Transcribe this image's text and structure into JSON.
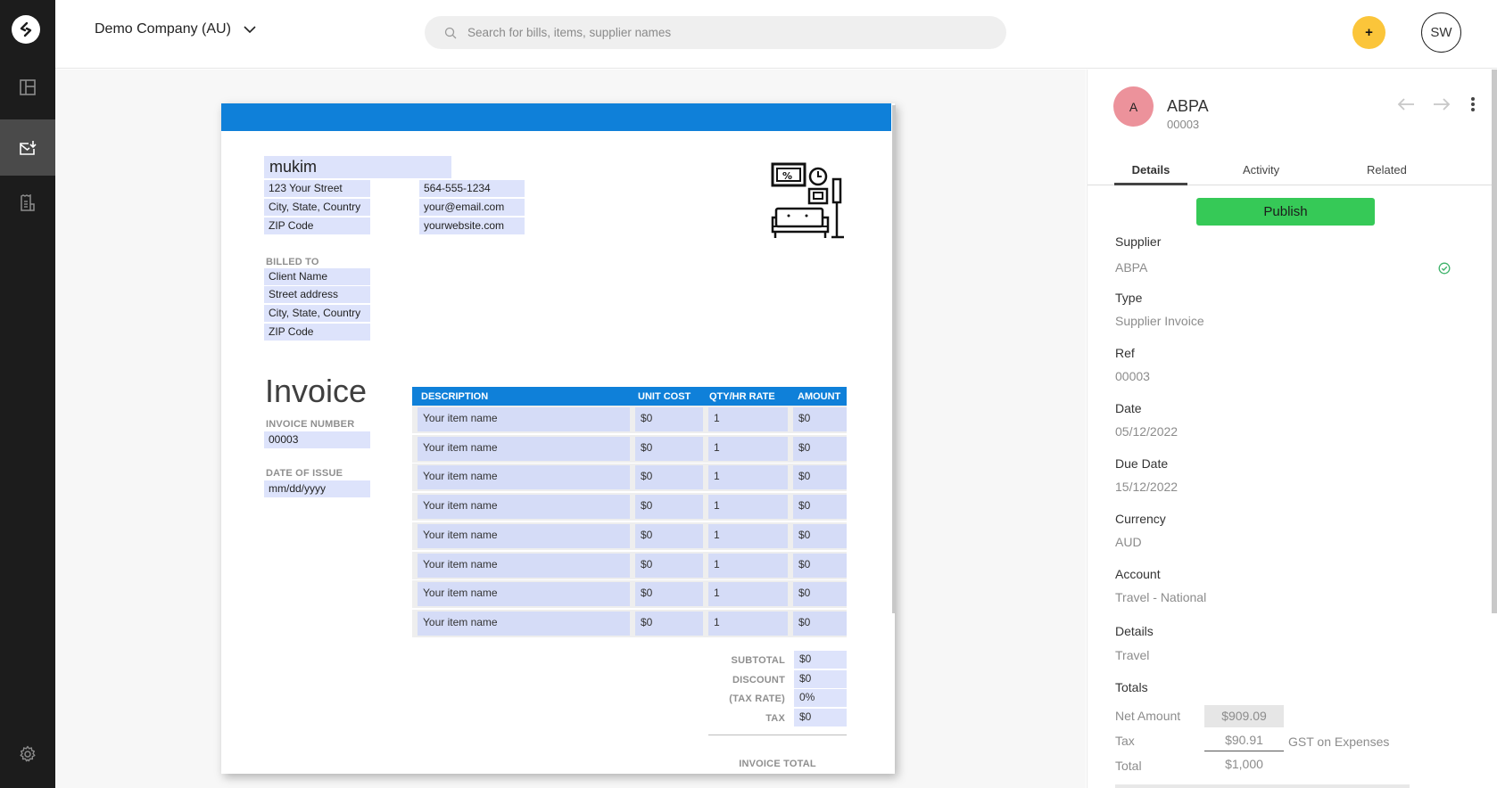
{
  "app": {
    "company": "Demo Company (AU)",
    "search_placeholder": "Search for bills, items, supplier names",
    "add_label": "+",
    "user_initials": "SW"
  },
  "sidebar": {
    "items": [
      {
        "name": "dashboard",
        "icon": "layout-icon",
        "active": false
      },
      {
        "name": "inbox",
        "icon": "inbox-download-icon",
        "active": true
      },
      {
        "name": "reports",
        "icon": "receipt-icon",
        "active": false
      }
    ],
    "settings_icon": "gear-icon"
  },
  "invoice": {
    "business_name": "mukim",
    "address": [
      "123 Your Street",
      "City, State, Country",
      "ZIP Code"
    ],
    "contact": [
      "564-555-1234",
      "your@email.com",
      "yourwebsite.com"
    ],
    "billed_to_label": "BILLED TO",
    "billed_to": [
      "Client Name",
      "Street address",
      "City, State, Country",
      "ZIP Code"
    ],
    "title": "Invoice",
    "invoice_number_label": "INVOICE NUMBER",
    "invoice_number": "00003",
    "date_label": "DATE OF ISSUE",
    "date_value": "mm/dd/yyyy",
    "columns": [
      "DESCRIPTION",
      "UNIT COST",
      "QTY/HR RATE",
      "AMOUNT"
    ],
    "rows": [
      {
        "desc": "Your item name",
        "unit": "$0",
        "qty": "1",
        "amount": "$0"
      },
      {
        "desc": "Your item name",
        "unit": "$0",
        "qty": "1",
        "amount": "$0"
      },
      {
        "desc": "Your item name",
        "unit": "$0",
        "qty": "1",
        "amount": "$0"
      },
      {
        "desc": "Your item name",
        "unit": "$0",
        "qty": "1",
        "amount": "$0"
      },
      {
        "desc": "Your item name",
        "unit": "$0",
        "qty": "1",
        "amount": "$0"
      },
      {
        "desc": "Your item name",
        "unit": "$0",
        "qty": "1",
        "amount": "$0"
      },
      {
        "desc": "Your item name",
        "unit": "$0",
        "qty": "1",
        "amount": "$0"
      },
      {
        "desc": "Your item name",
        "unit": "$0",
        "qty": "1",
        "amount": "$0"
      }
    ],
    "summary": [
      {
        "label": "SUBTOTAL",
        "value": "$0"
      },
      {
        "label": "DISCOUNT",
        "value": "$0"
      },
      {
        "label": "(TAX RATE)",
        "value": "0%"
      },
      {
        "label": "TAX",
        "value": "$0"
      }
    ],
    "total_label": "INVOICE TOTAL"
  },
  "panel": {
    "avatar_letter": "A",
    "supplier_name": "ABPA",
    "supplier_ref": "00003",
    "tabs": [
      "Details",
      "Activity",
      "Related"
    ],
    "active_tab": "Details",
    "publish_label": "Publish",
    "fields": [
      {
        "label": "Supplier",
        "value": "ABPA"
      },
      {
        "label": "Type",
        "value": "Supplier Invoice"
      },
      {
        "label": "Ref",
        "value": "00003"
      },
      {
        "label": "Date",
        "value": "05/12/2022"
      },
      {
        "label": "Due Date",
        "value": "15/12/2022"
      },
      {
        "label": "Currency",
        "value": "AUD"
      },
      {
        "label": "Account",
        "value": "Travel - National"
      },
      {
        "label": "Details",
        "value": "Travel"
      }
    ],
    "totals_label": "Totals",
    "net_label": "Net Amount",
    "net_value": "$909.09",
    "tax_label": "Tax",
    "tax_value": "$90.91",
    "tax_type": "GST on Expenses",
    "total_label": "Total",
    "total_value": "$1,000"
  }
}
